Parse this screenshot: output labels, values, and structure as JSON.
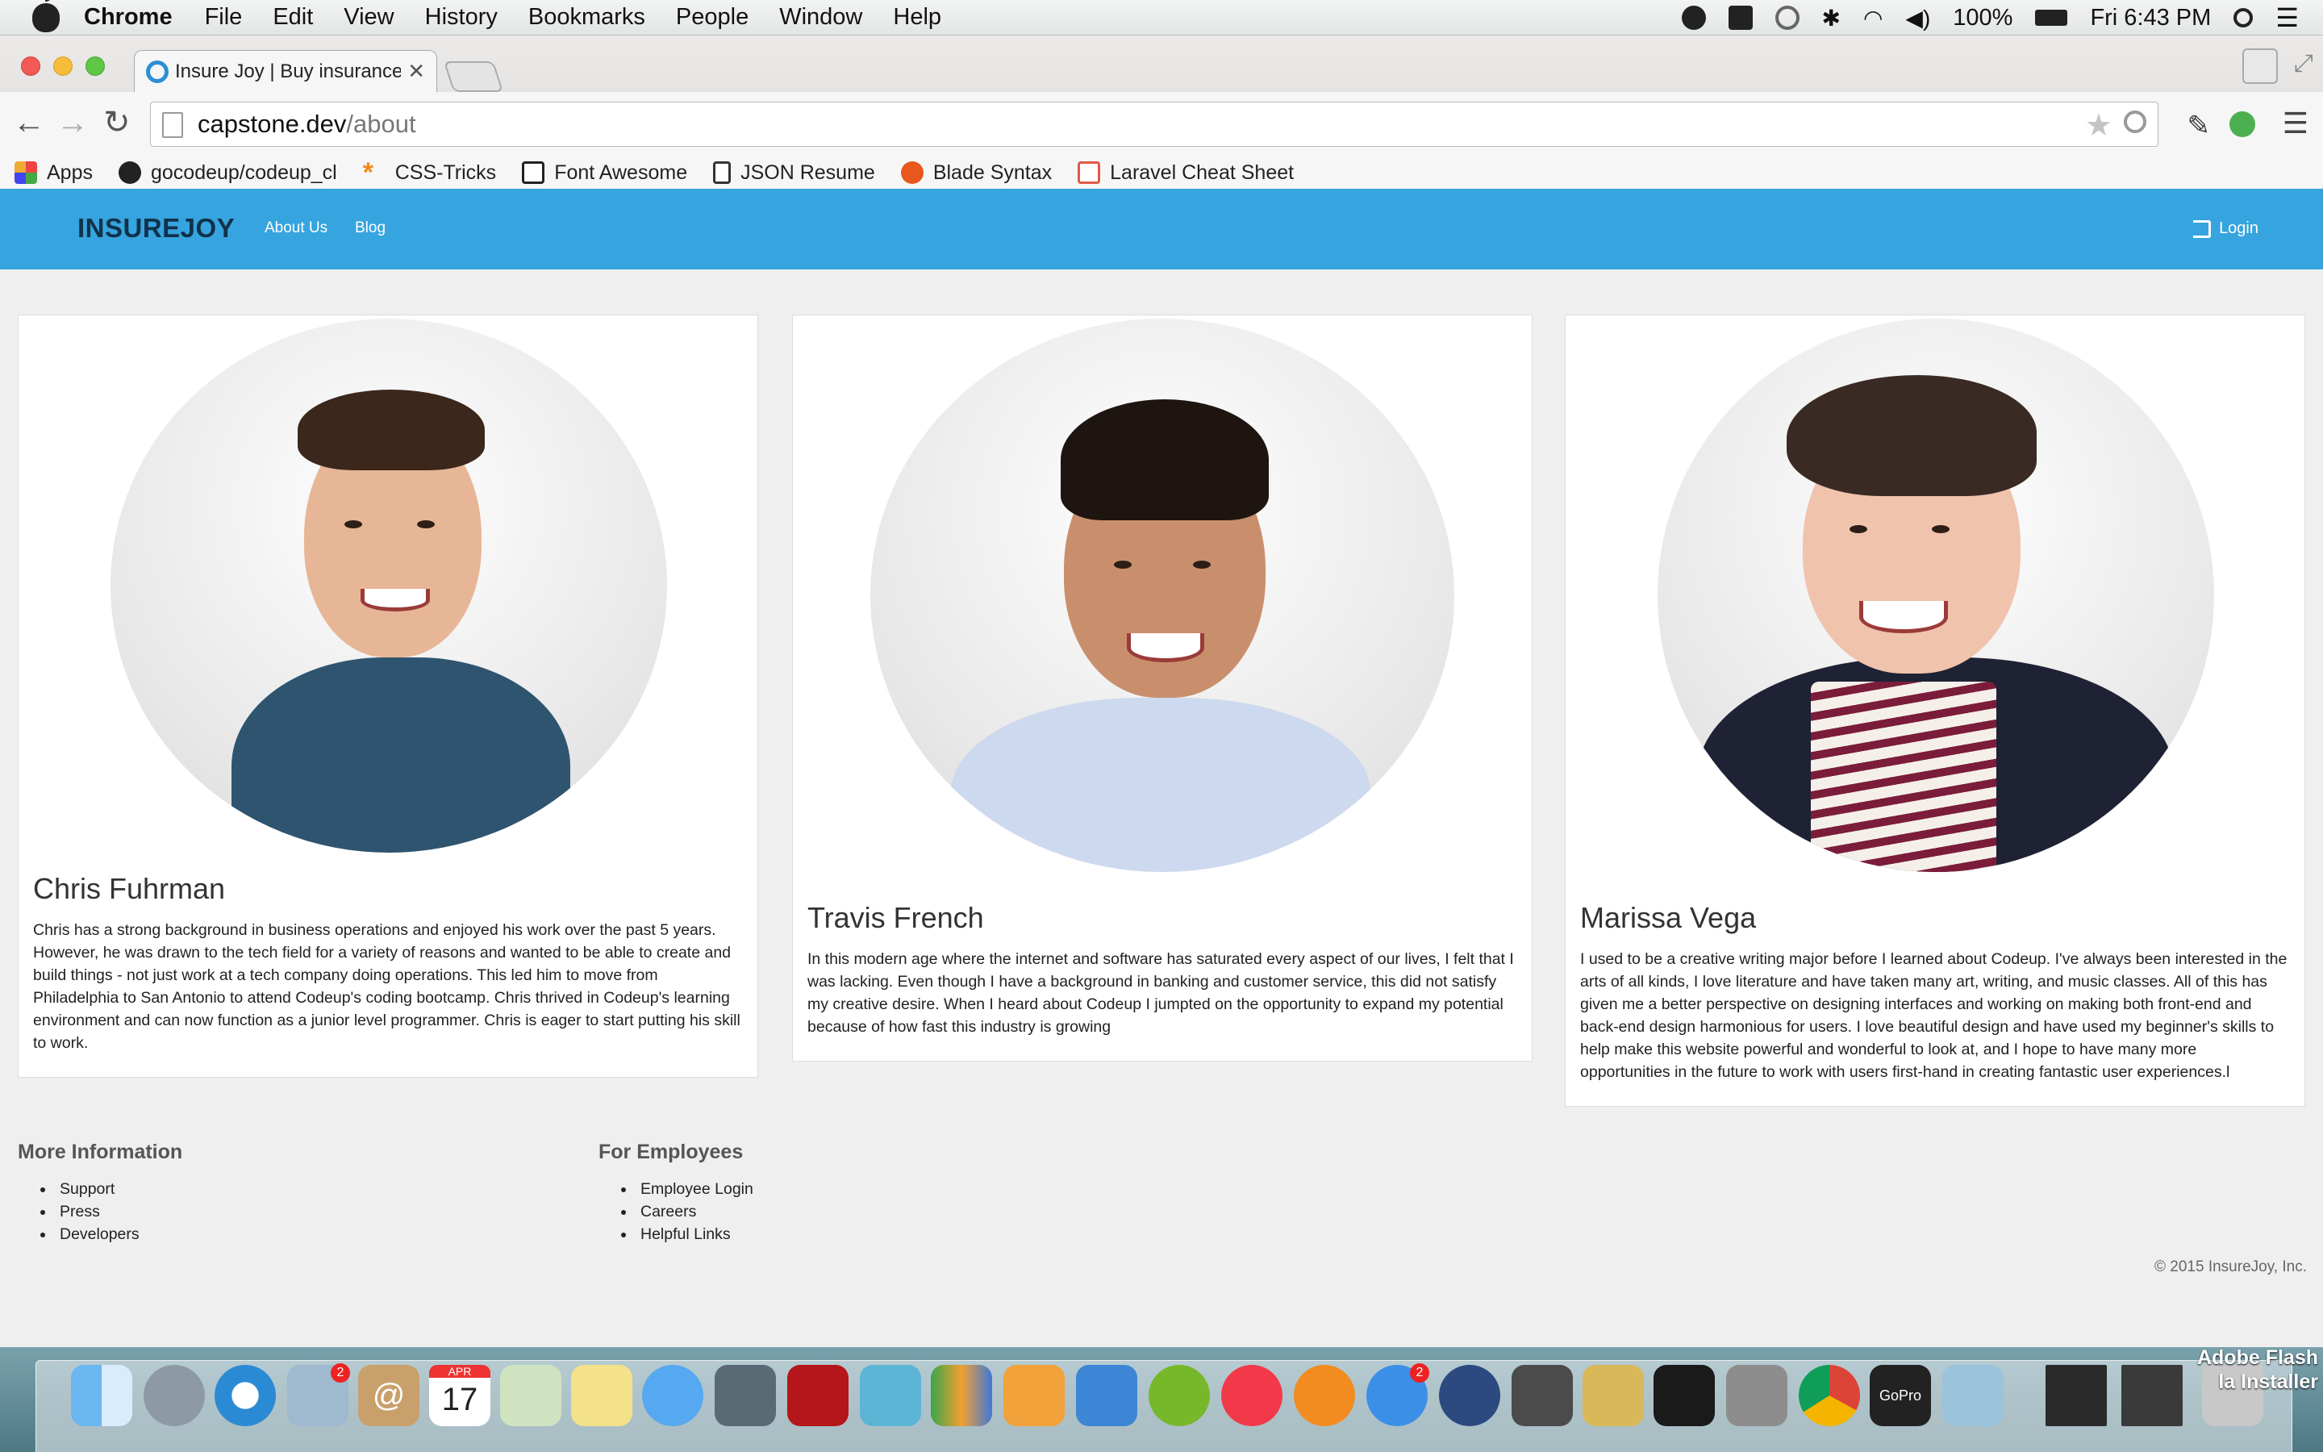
{
  "menubar": {
    "app_name": "Chrome",
    "items": [
      "File",
      "Edit",
      "View",
      "History",
      "Bookmarks",
      "People",
      "Window",
      "Help"
    ],
    "battery": "100%",
    "clock": "Fri 6:43 PM"
  },
  "browser": {
    "tab_title": "Insure Joy | Buy insurance",
    "url_domain": "capstone.dev",
    "url_path": "/about",
    "bookmarks": [
      "Apps",
      "gocodeup/codeup_cl",
      "CSS-Tricks",
      "Font Awesome",
      "JSON Resume",
      "Blade Syntax",
      "Laravel Cheat Sheet"
    ]
  },
  "site": {
    "brand": "INSUREJOY",
    "nav": [
      "About Us",
      "Blog"
    ],
    "login": "Login"
  },
  "team": [
    {
      "name": "Chris Fuhrman",
      "bio": "Chris has a strong background in business operations and enjoyed his work over the past 5 years. However, he was drawn to the tech field for a variety of reasons and wanted to be able to create and build things - not just work at a tech company doing operations. This led him to move from Philadelphia to San Antonio to attend Codeup's coding bootcamp. Chris thrived in Codeup's learning environment and can now function as a junior level programmer. Chris is eager to start putting his skill to work."
    },
    {
      "name": "Travis French",
      "bio": "In this modern age where the internet and software has saturated every aspect of our lives, I felt that I was lacking. Even though I have a background in banking and customer service, this did not satisfy my creative desire. When I heard about Codeup I jumpted on the opportunity to expand my potential because of how fast this industry is growing"
    },
    {
      "name": "Marissa Vega",
      "bio": "I used to be a creative writing major before I learned about Codeup. I've always been interested in the arts of all kinds, I love literature and have taken many art, writing, and music classes. All of this has given me a better perspective on designing interfaces and working on making both front-end and back-end design harmonious for users. I love beautiful design and have used my beginner's skills to help make this website powerful and wonderful to look at, and I hope to have many more opportunities in the future to work with users first-hand in creating fantastic user experiences.l"
    }
  ],
  "footer": {
    "col1_title": "More Information",
    "col1_links": [
      "Support",
      "Press",
      "Developers"
    ],
    "col2_title": "For Employees",
    "col2_links": [
      "Employee Login",
      "Careers",
      "Helpful Links"
    ],
    "copyright": "© 2015 InsureJoy, Inc."
  },
  "dock": {
    "calendar_month": "APR",
    "calendar_day": "17",
    "mail_badge": "2",
    "appstore_badge": "2",
    "gopro_label": "GoPro",
    "flash_line1": "Adobe Flash",
    "flash_line2": "la Installer"
  }
}
